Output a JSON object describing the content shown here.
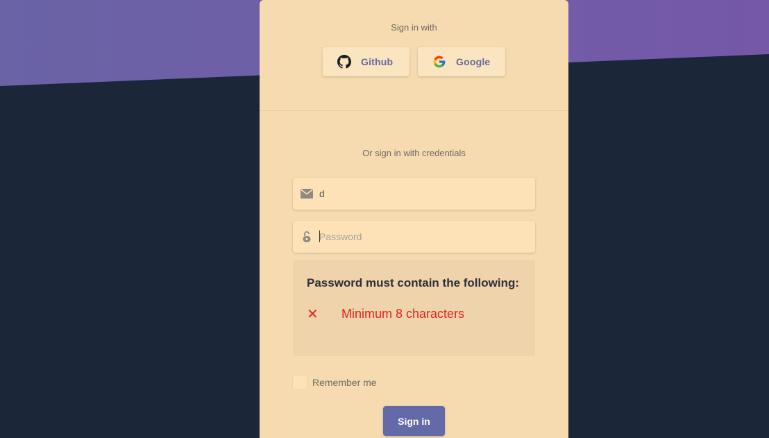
{
  "social": {
    "heading": "Sign in with",
    "github_label": "Github",
    "google_label": "Google"
  },
  "credentials": {
    "heading": "Or sign in with credentials",
    "email_value": "d",
    "email_icon": "envelope-icon",
    "password_placeholder": "Password",
    "password_value": "",
    "password_icon": "unlock-icon"
  },
  "password_requirements": {
    "title": "Password must contain the following:",
    "items": [
      {
        "status": "failed",
        "icon": "✕",
        "text": "Minimum 8 characters"
      }
    ],
    "fail_color": "#e0241f"
  },
  "remember": {
    "label": "Remember me",
    "checked": false
  },
  "submit": {
    "label": "Sign in"
  },
  "colors": {
    "page_background": "#1b2638",
    "hero_gradient_start": "#6a63a6",
    "hero_gradient_end": "#7558a8",
    "card_background": "#f6dbb0",
    "accent": "#646aa7"
  }
}
